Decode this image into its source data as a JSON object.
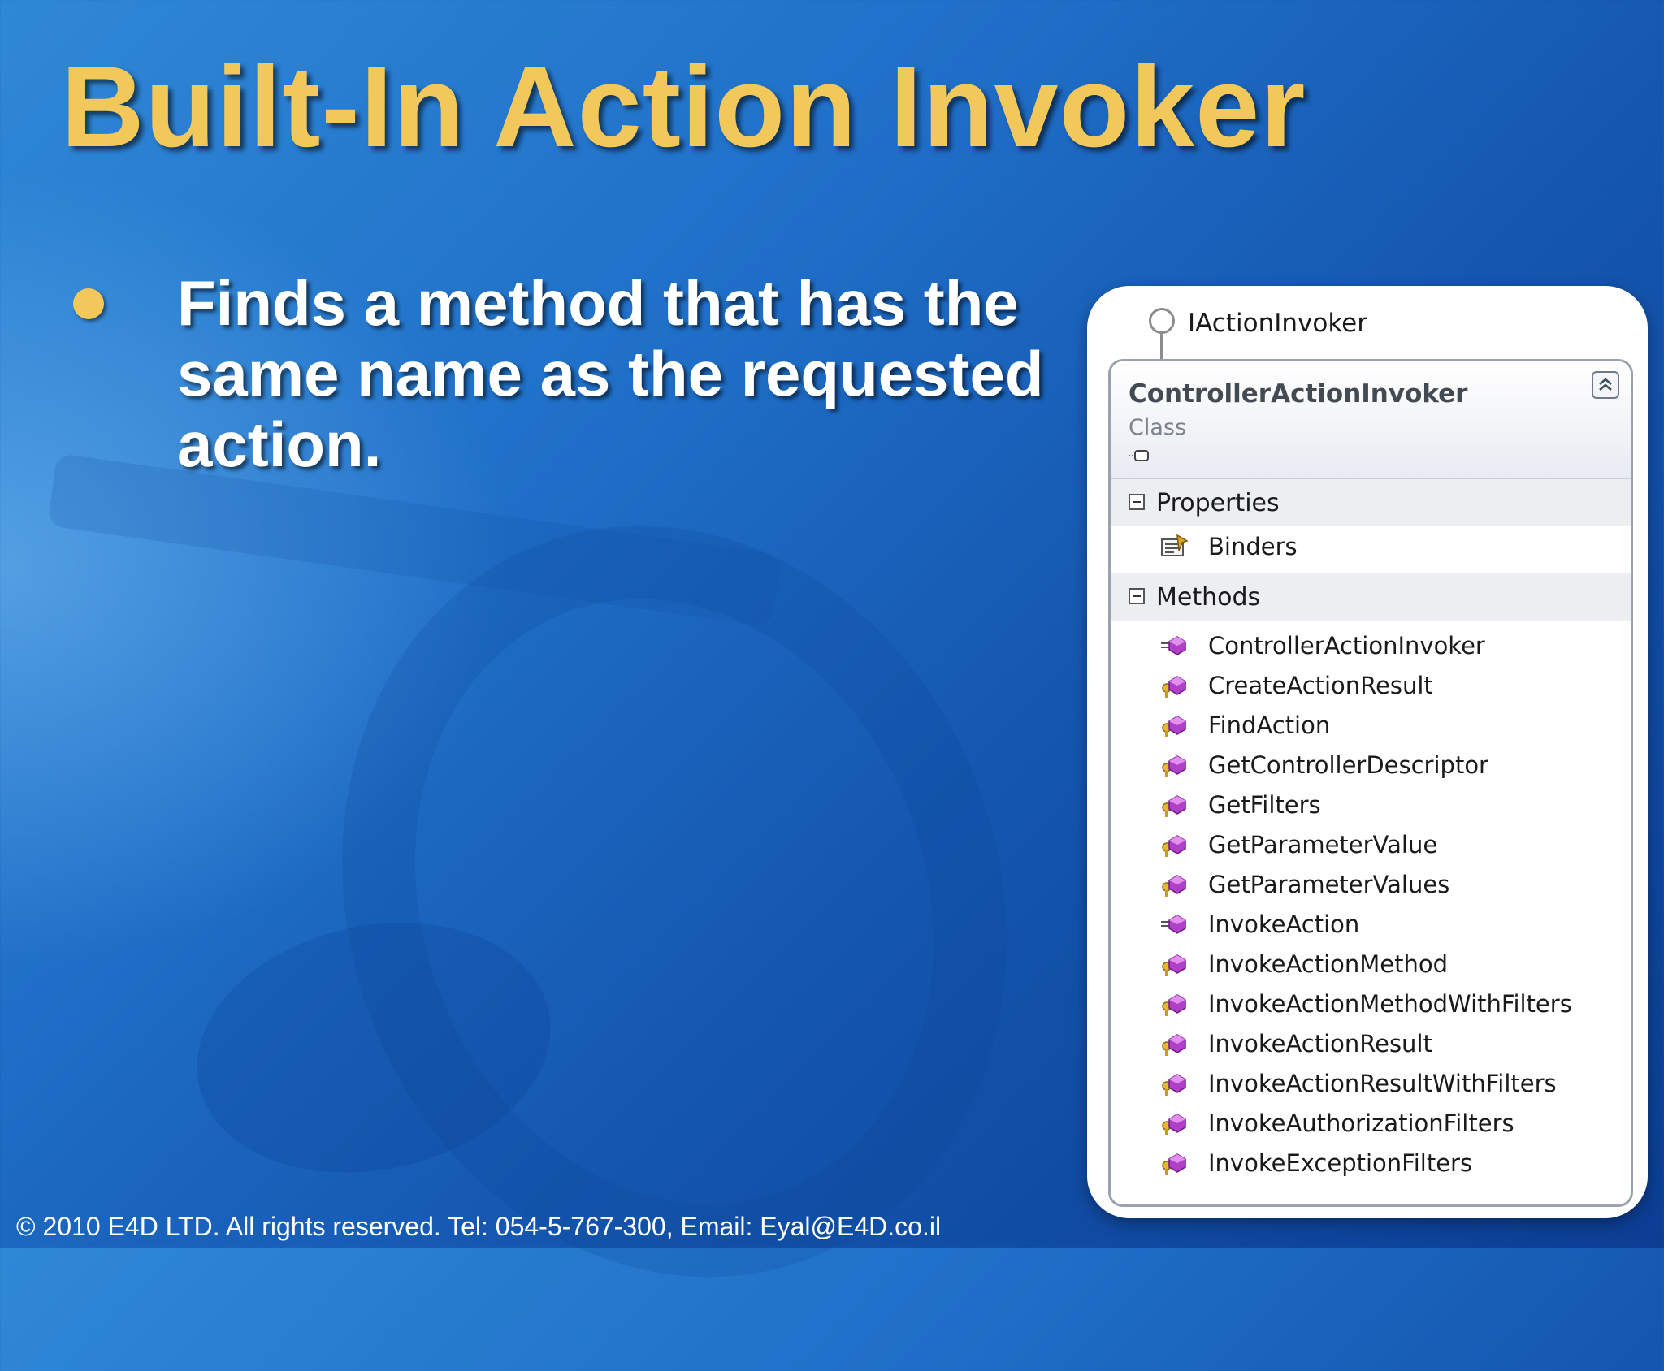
{
  "slide": {
    "title": "Built-In Action Invoker",
    "bullet": "Finds a method that has the same name as the requested action.",
    "footer": "© 2010 E4D LTD. All rights reserved. Tel: 054-5-767-300, Email: Eyal@E4D.co.il"
  },
  "diagram": {
    "interface": "IActionInvoker",
    "class_name": "ControllerActionInvoker",
    "class_kind": "Class",
    "collapse_icon": "double-chevron-up-icon",
    "properties_label": "Properties",
    "properties": [
      "Binders"
    ],
    "methods_label": "Methods",
    "methods": [
      {
        "name": "ControllerActionInvoker",
        "icon": "public-method-icon"
      },
      {
        "name": "CreateActionResult",
        "icon": "protected-method-icon"
      },
      {
        "name": "FindAction",
        "icon": "protected-method-icon"
      },
      {
        "name": "GetControllerDescriptor",
        "icon": "protected-method-icon"
      },
      {
        "name": "GetFilters",
        "icon": "protected-method-icon"
      },
      {
        "name": "GetParameterValue",
        "icon": "protected-method-icon"
      },
      {
        "name": "GetParameterValues",
        "icon": "protected-method-icon"
      },
      {
        "name": "InvokeAction",
        "icon": "public-method-icon"
      },
      {
        "name": "InvokeActionMethod",
        "icon": "protected-method-icon"
      },
      {
        "name": "InvokeActionMethodWithFilters",
        "icon": "protected-method-icon"
      },
      {
        "name": "InvokeActionResult",
        "icon": "protected-method-icon"
      },
      {
        "name": "InvokeActionResultWithFilters",
        "icon": "protected-method-icon"
      },
      {
        "name": "InvokeAuthorizationFilters",
        "icon": "protected-method-icon"
      },
      {
        "name": "InvokeExceptionFilters",
        "icon": "protected-method-icon"
      }
    ]
  },
  "colors": {
    "title": "#f3c85a",
    "bullet": "#f3c85a",
    "text": "#ffffff",
    "background": "#1f6fc8"
  }
}
